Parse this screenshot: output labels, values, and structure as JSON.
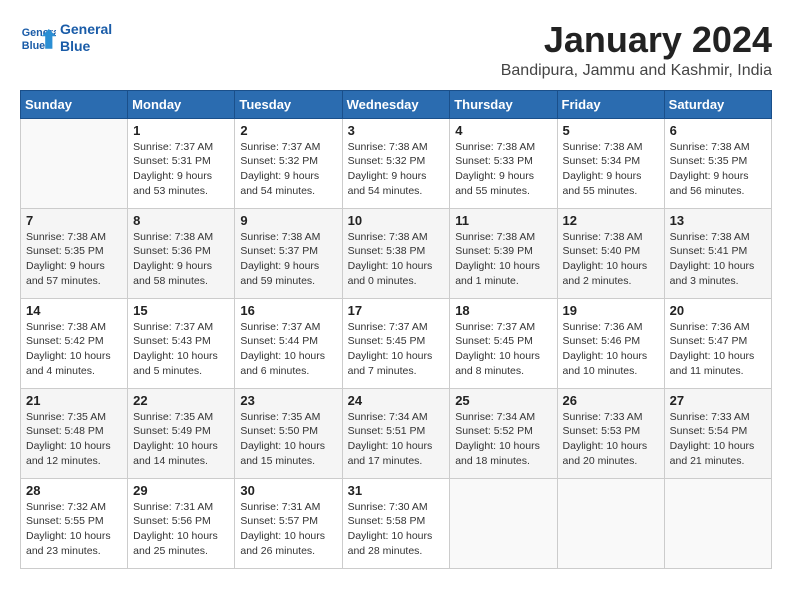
{
  "header": {
    "logo_text_general": "General",
    "logo_text_blue": "Blue",
    "month_title": "January 2024",
    "subtitle": "Bandipura, Jammu and Kashmir, India"
  },
  "calendar": {
    "weekdays": [
      "Sunday",
      "Monday",
      "Tuesday",
      "Wednesday",
      "Thursday",
      "Friday",
      "Saturday"
    ],
    "weeks": [
      [
        {
          "day": "",
          "info": ""
        },
        {
          "day": "1",
          "info": "Sunrise: 7:37 AM\nSunset: 5:31 PM\nDaylight: 9 hours\nand 53 minutes."
        },
        {
          "day": "2",
          "info": "Sunrise: 7:37 AM\nSunset: 5:32 PM\nDaylight: 9 hours\nand 54 minutes."
        },
        {
          "day": "3",
          "info": "Sunrise: 7:38 AM\nSunset: 5:32 PM\nDaylight: 9 hours\nand 54 minutes."
        },
        {
          "day": "4",
          "info": "Sunrise: 7:38 AM\nSunset: 5:33 PM\nDaylight: 9 hours\nand 55 minutes."
        },
        {
          "day": "5",
          "info": "Sunrise: 7:38 AM\nSunset: 5:34 PM\nDaylight: 9 hours\nand 55 minutes."
        },
        {
          "day": "6",
          "info": "Sunrise: 7:38 AM\nSunset: 5:35 PM\nDaylight: 9 hours\nand 56 minutes."
        }
      ],
      [
        {
          "day": "7",
          "info": "Sunrise: 7:38 AM\nSunset: 5:35 PM\nDaylight: 9 hours\nand 57 minutes."
        },
        {
          "day": "8",
          "info": "Sunrise: 7:38 AM\nSunset: 5:36 PM\nDaylight: 9 hours\nand 58 minutes."
        },
        {
          "day": "9",
          "info": "Sunrise: 7:38 AM\nSunset: 5:37 PM\nDaylight: 9 hours\nand 59 minutes."
        },
        {
          "day": "10",
          "info": "Sunrise: 7:38 AM\nSunset: 5:38 PM\nDaylight: 10 hours\nand 0 minutes."
        },
        {
          "day": "11",
          "info": "Sunrise: 7:38 AM\nSunset: 5:39 PM\nDaylight: 10 hours\nand 1 minute."
        },
        {
          "day": "12",
          "info": "Sunrise: 7:38 AM\nSunset: 5:40 PM\nDaylight: 10 hours\nand 2 minutes."
        },
        {
          "day": "13",
          "info": "Sunrise: 7:38 AM\nSunset: 5:41 PM\nDaylight: 10 hours\nand 3 minutes."
        }
      ],
      [
        {
          "day": "14",
          "info": "Sunrise: 7:38 AM\nSunset: 5:42 PM\nDaylight: 10 hours\nand 4 minutes."
        },
        {
          "day": "15",
          "info": "Sunrise: 7:37 AM\nSunset: 5:43 PM\nDaylight: 10 hours\nand 5 minutes."
        },
        {
          "day": "16",
          "info": "Sunrise: 7:37 AM\nSunset: 5:44 PM\nDaylight: 10 hours\nand 6 minutes."
        },
        {
          "day": "17",
          "info": "Sunrise: 7:37 AM\nSunset: 5:45 PM\nDaylight: 10 hours\nand 7 minutes."
        },
        {
          "day": "18",
          "info": "Sunrise: 7:37 AM\nSunset: 5:45 PM\nDaylight: 10 hours\nand 8 minutes."
        },
        {
          "day": "19",
          "info": "Sunrise: 7:36 AM\nSunset: 5:46 PM\nDaylight: 10 hours\nand 10 minutes."
        },
        {
          "day": "20",
          "info": "Sunrise: 7:36 AM\nSunset: 5:47 PM\nDaylight: 10 hours\nand 11 minutes."
        }
      ],
      [
        {
          "day": "21",
          "info": "Sunrise: 7:35 AM\nSunset: 5:48 PM\nDaylight: 10 hours\nand 12 minutes."
        },
        {
          "day": "22",
          "info": "Sunrise: 7:35 AM\nSunset: 5:49 PM\nDaylight: 10 hours\nand 14 minutes."
        },
        {
          "day": "23",
          "info": "Sunrise: 7:35 AM\nSunset: 5:50 PM\nDaylight: 10 hours\nand 15 minutes."
        },
        {
          "day": "24",
          "info": "Sunrise: 7:34 AM\nSunset: 5:51 PM\nDaylight: 10 hours\nand 17 minutes."
        },
        {
          "day": "25",
          "info": "Sunrise: 7:34 AM\nSunset: 5:52 PM\nDaylight: 10 hours\nand 18 minutes."
        },
        {
          "day": "26",
          "info": "Sunrise: 7:33 AM\nSunset: 5:53 PM\nDaylight: 10 hours\nand 20 minutes."
        },
        {
          "day": "27",
          "info": "Sunrise: 7:33 AM\nSunset: 5:54 PM\nDaylight: 10 hours\nand 21 minutes."
        }
      ],
      [
        {
          "day": "28",
          "info": "Sunrise: 7:32 AM\nSunset: 5:55 PM\nDaylight: 10 hours\nand 23 minutes."
        },
        {
          "day": "29",
          "info": "Sunrise: 7:31 AM\nSunset: 5:56 PM\nDaylight: 10 hours\nand 25 minutes."
        },
        {
          "day": "30",
          "info": "Sunrise: 7:31 AM\nSunset: 5:57 PM\nDaylight: 10 hours\nand 26 minutes."
        },
        {
          "day": "31",
          "info": "Sunrise: 7:30 AM\nSunset: 5:58 PM\nDaylight: 10 hours\nand 28 minutes."
        },
        {
          "day": "",
          "info": ""
        },
        {
          "day": "",
          "info": ""
        },
        {
          "day": "",
          "info": ""
        }
      ]
    ]
  }
}
